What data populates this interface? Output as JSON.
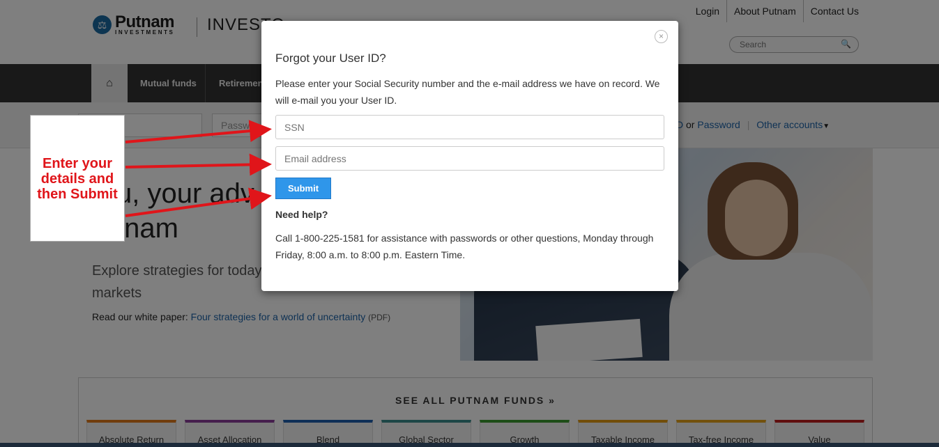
{
  "header": {
    "logo_name": "Putnam",
    "logo_sub": "INVESTMENTS",
    "section": "INVESTO",
    "utility": [
      "Login",
      "About Putnam",
      "Contact Us"
    ],
    "search_placeholder": "Search"
  },
  "nav": {
    "items": [
      "Mutual funds",
      "Retiremen"
    ]
  },
  "loginbar": {
    "password_placeholder": "Passwor",
    "id_link_tail": "D",
    "or": "or",
    "password_link": "Password",
    "other_accounts": "Other accounts"
  },
  "hero": {
    "title_line1": "u, your adv",
    "title_line2": "tnam",
    "sub_line1": "Explore strategies for today",
    "sub_line2": "markets",
    "read_prefix": "Read our white paper:",
    "read_link": "Four strategies for a world of uncertainty",
    "read_suffix": "(PDF)"
  },
  "funds": {
    "title": "SEE ALL PUTNAM FUNDS »",
    "tabs": [
      {
        "label": "Absolute Return",
        "color": "#e07b1a"
      },
      {
        "label": "Asset Allocation",
        "color": "#8a3d9a"
      },
      {
        "label": "Blend",
        "color": "#1f5fae"
      },
      {
        "label": "Global Sector",
        "color": "#3a8d8c"
      },
      {
        "label": "Growth",
        "color": "#3b9a2f"
      },
      {
        "label": "Taxable Income",
        "color": "#e39a12"
      },
      {
        "label": "Tax-free Income",
        "color": "#e5a21a"
      },
      {
        "label": "Value",
        "color": "#c01e1e"
      }
    ]
  },
  "modal": {
    "title": "Forgot your User ID?",
    "description": "Please enter your Social Security number and the e-mail address we have on record. We will e-mail you your User ID.",
    "ssn_placeholder": "SSN",
    "email_placeholder": "Email address",
    "submit_label": "Submit",
    "help_heading": "Need help?",
    "help_text": "Call 1-800-225-1581 for assistance with passwords or other questions, Monday through Friday, 8:00 a.m. to 8:00 p.m. Eastern Time.",
    "close_icon": "×"
  },
  "annotation": {
    "text_line1": "Enter your",
    "text_line2": "details and",
    "text_line3": "then Submit",
    "color": "#e0151a"
  }
}
